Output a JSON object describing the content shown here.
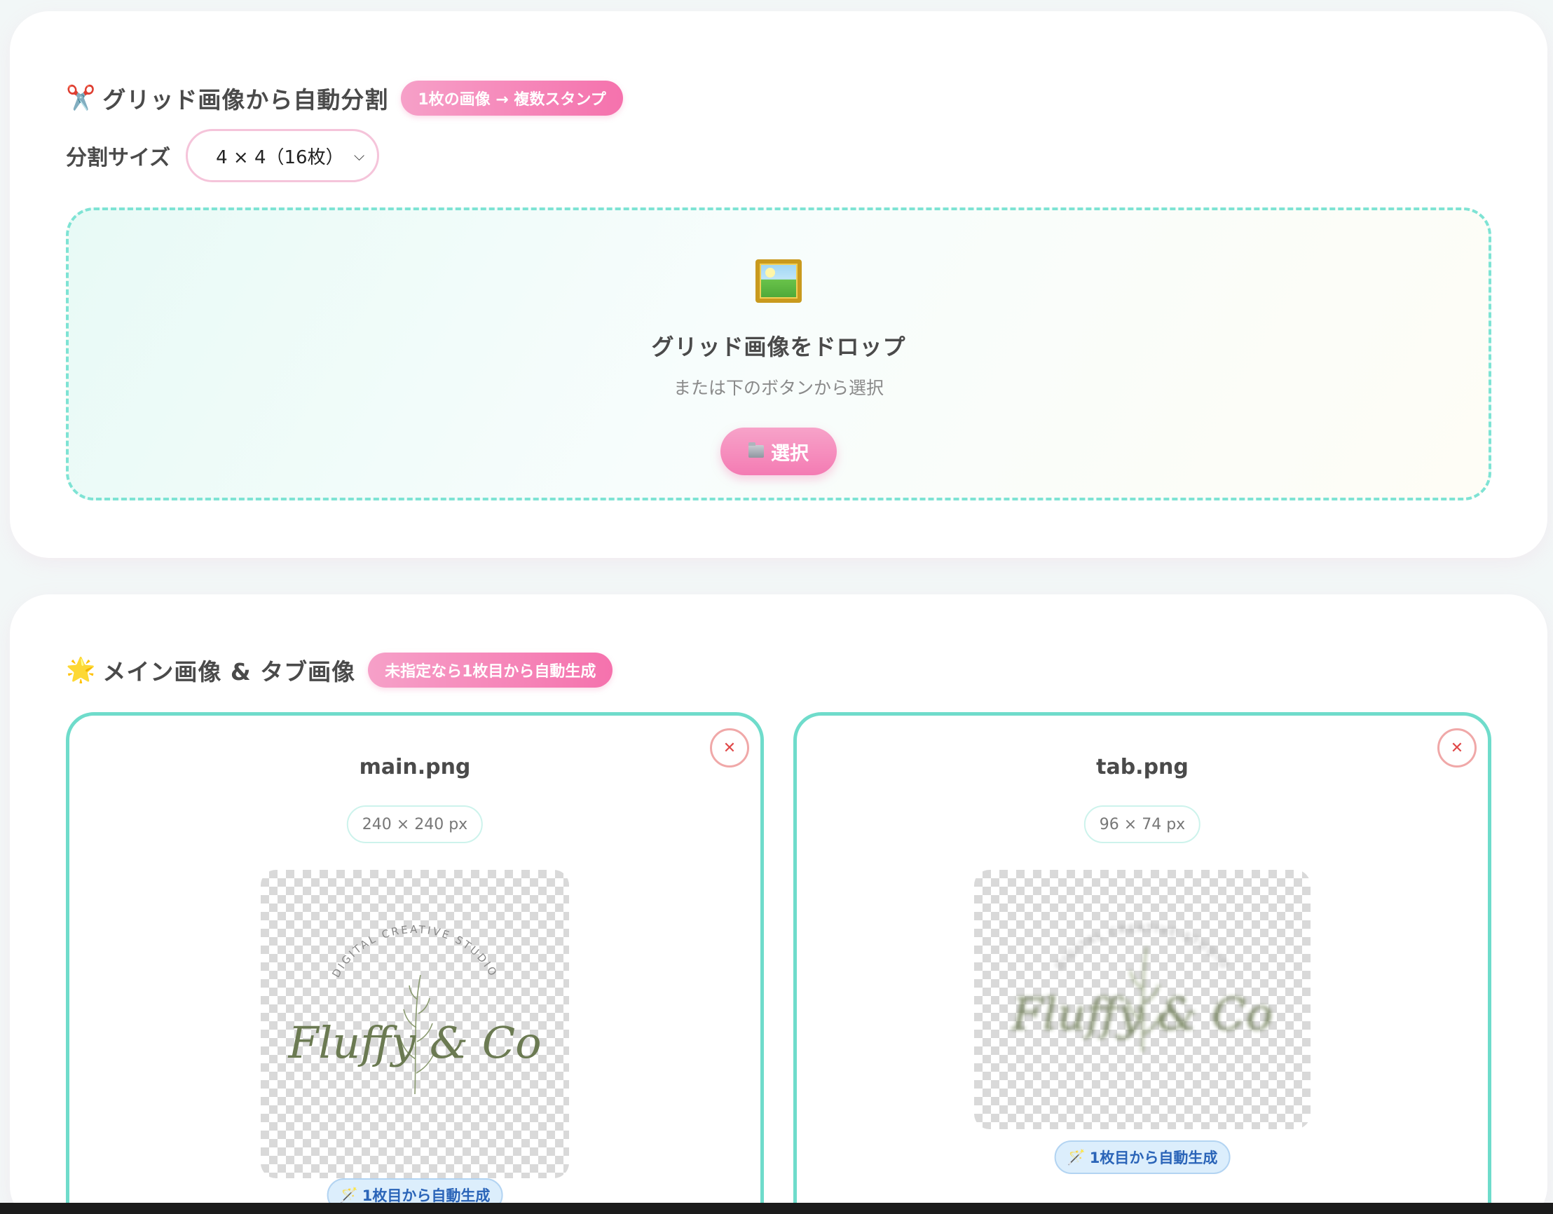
{
  "split_section": {
    "icon": "scissors-icon",
    "title": "グリッド画像から自動分割",
    "badge": "1枚の画像 → 複数スタンプ",
    "size_label": "分割サイズ",
    "size_value": "4 × 4（16枚）",
    "drop_title": "グリッド画像をドロップ",
    "drop_subtitle": "または下のボタンから選択",
    "select_button": "選択"
  },
  "main_section": {
    "icon": "star-icon",
    "title": "メイン画像 & タブ画像",
    "badge": "未指定なら1枚目から自動生成",
    "cards": [
      {
        "file_name": "main.png",
        "dims": "240 × 240 px",
        "auto_label": "1枚目から自動生成",
        "logo_arc": "DIGITAL CREATIVE STUDIO",
        "logo_script": "Fluffy & Co"
      },
      {
        "file_name": "tab.png",
        "dims": "96 × 74 px",
        "auto_label": "1枚目から自動生成",
        "logo_arc": "DIGITAL CREATIVE STUDIO",
        "logo_script": "Fluffy & Co"
      }
    ]
  },
  "colors": {
    "accent_pink": "#f572ad",
    "accent_teal": "#6fdccb",
    "close_red": "#e04848"
  }
}
